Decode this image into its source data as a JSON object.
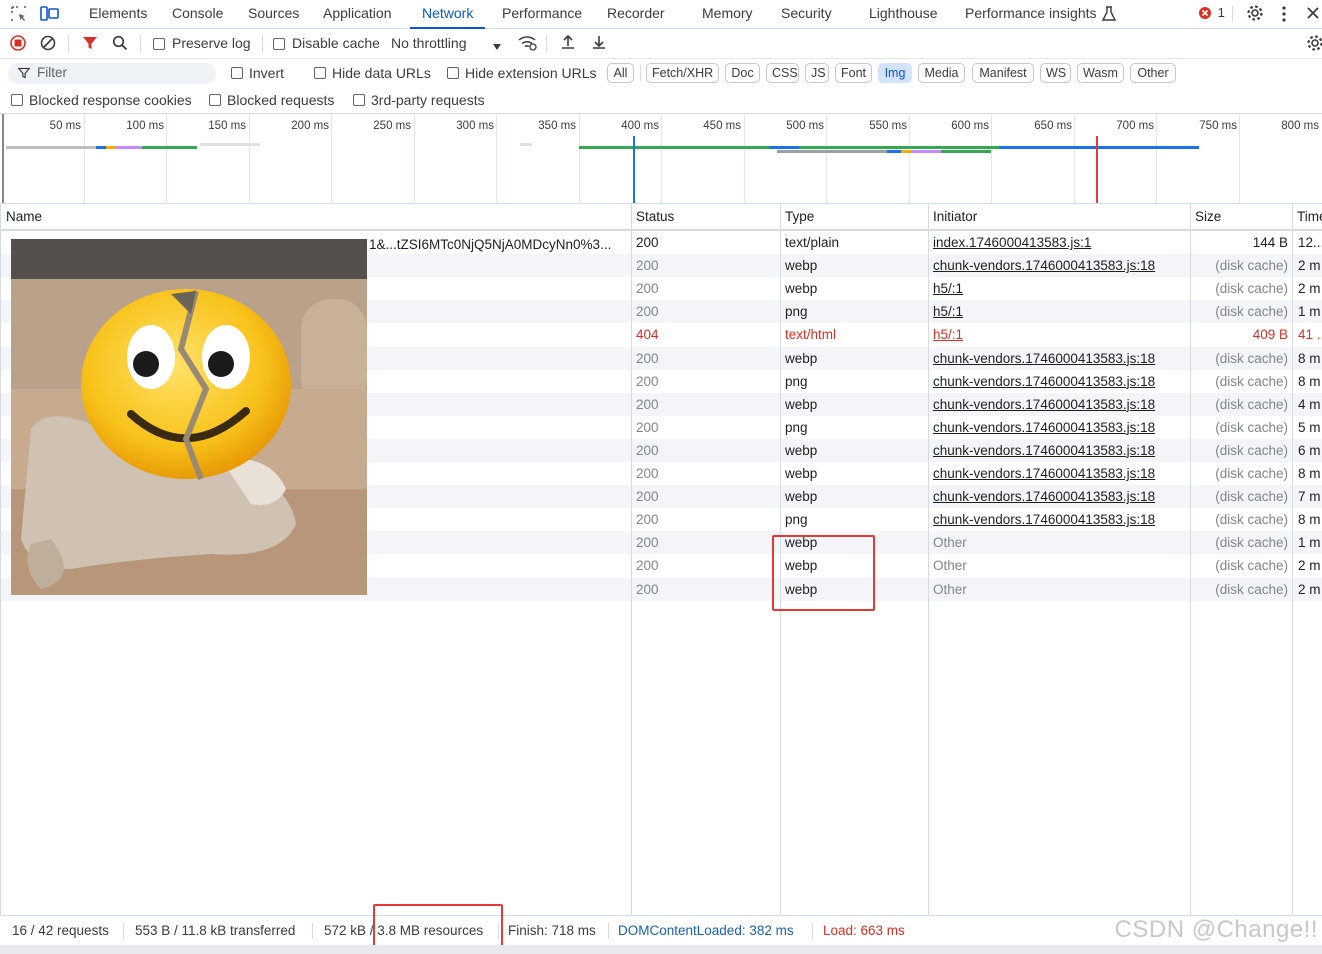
{
  "tabs": [
    {
      "label": "Elements"
    },
    {
      "label": "Console"
    },
    {
      "label": "Sources"
    },
    {
      "label": "Application"
    },
    {
      "label": "Network"
    },
    {
      "label": "Performance"
    },
    {
      "label": "Recorder"
    },
    {
      "label": "Memory"
    },
    {
      "label": "Security"
    },
    {
      "label": "Lighthouse"
    },
    {
      "label": "Performance insights"
    }
  ],
  "error_count": "1",
  "toolbar": {
    "preserve_log": "Preserve log",
    "disable_cache": "Disable cache",
    "throttling": "No throttling"
  },
  "filter_bar": {
    "placeholder": "Filter",
    "invert": "Invert",
    "hide_data_urls": "Hide data URLs",
    "hide_extension_urls": "Hide extension URLs",
    "types": [
      "All",
      "Fetch/XHR",
      "Doc",
      "CSS",
      "JS",
      "Font",
      "Img",
      "Media",
      "Manifest",
      "WS",
      "Wasm",
      "Other"
    ],
    "active_type": "Img"
  },
  "filter_row2": {
    "blocked_response_cookies": "Blocked response cookies",
    "blocked_requests": "Blocked requests",
    "third_party": "3rd-party requests"
  },
  "overview": {
    "ticks": [
      "50 ms",
      "100 ms",
      "150 ms",
      "200 ms",
      "250 ms",
      "300 ms",
      "350 ms",
      "400 ms",
      "450 ms",
      "500 ms",
      "550 ms",
      "600 ms",
      "650 ms",
      "700 ms",
      "750 ms",
      "800 ms"
    ]
  },
  "table": {
    "columns": {
      "name": "Name",
      "status": "Status",
      "type": "Type",
      "initiator": "Initiator",
      "size": "Size",
      "time": "Time"
    },
    "rows": [
      {
        "name": "1&...tZSI6MTc0NjQ5NjA0MDcyNn0%3...",
        "status": "200",
        "type": "text/plain",
        "initiator": "index.1746000413583.js:1",
        "size": "144 B",
        "time": "12..."
      },
      {
        "name": "",
        "status": "200",
        "type": "webp",
        "initiator": "chunk-vendors.1746000413583.js:18",
        "size": "(disk cache)",
        "time": "2 m"
      },
      {
        "name": "",
        "status": "200",
        "type": "webp",
        "initiator": "h5/:1",
        "size": "(disk cache)",
        "time": "2 m"
      },
      {
        "name": "",
        "status": "200",
        "type": "png",
        "initiator": "h5/:1",
        "size": "(disk cache)",
        "time": "1 m"
      },
      {
        "name": "",
        "status": "404",
        "type": "text/html",
        "initiator": "h5/:1",
        "size": "409 B",
        "time": "41 ..."
      },
      {
        "name": "",
        "status": "200",
        "type": "webp",
        "initiator": "chunk-vendors.1746000413583.js:18",
        "size": "(disk cache)",
        "time": "8 m"
      },
      {
        "name": "",
        "status": "200",
        "type": "png",
        "initiator": "chunk-vendors.1746000413583.js:18",
        "size": "(disk cache)",
        "time": "8 m"
      },
      {
        "name": "",
        "status": "200",
        "type": "webp",
        "initiator": "chunk-vendors.1746000413583.js:18",
        "size": "(disk cache)",
        "time": "4 m"
      },
      {
        "name": "",
        "status": "200",
        "type": "png",
        "initiator": "chunk-vendors.1746000413583.js:18",
        "size": "(disk cache)",
        "time": "5 m"
      },
      {
        "name": "",
        "status": "200",
        "type": "webp",
        "initiator": "chunk-vendors.1746000413583.js:18",
        "size": "(disk cache)",
        "time": "6 m"
      },
      {
        "name": "",
        "status": "200",
        "type": "webp",
        "initiator": "chunk-vendors.1746000413583.js:18",
        "size": "(disk cache)",
        "time": "8 m"
      },
      {
        "name": "",
        "status": "200",
        "type": "webp",
        "initiator": "chunk-vendors.1746000413583.js:18",
        "size": "(disk cache)",
        "time": "7 m"
      },
      {
        "name": "",
        "status": "200",
        "type": "png",
        "initiator": "chunk-vendors.1746000413583.js:18",
        "size": "(disk cache)",
        "time": "8 m"
      },
      {
        "name": "",
        "status": "200",
        "type": "webp",
        "initiator": "Other",
        "size": "(disk cache)",
        "time": "1 m"
      },
      {
        "name": "",
        "status": "200",
        "type": "webp",
        "initiator": "Other",
        "size": "(disk cache)",
        "time": "2 m"
      },
      {
        "name": "",
        "status": "200",
        "type": "webp",
        "initiator": "Other",
        "size": "(disk cache)",
        "time": "2 m"
      }
    ]
  },
  "statusbar": {
    "requests": "16 / 42 requests",
    "transferred": "553 B / 11.8 kB transferred",
    "resources": "572 kB / 3.8 MB resources",
    "finish": "Finish: 718 ms",
    "dom_content_loaded": "DOMContentLoaded: 382 ms",
    "load": "Load: 663 ms"
  },
  "watermark": "CSDN @Change!!",
  "colors": {
    "accent": "#0b57d0",
    "error": "#d93025",
    "dcl": "#1a73e8",
    "annotation": "#e53935"
  }
}
